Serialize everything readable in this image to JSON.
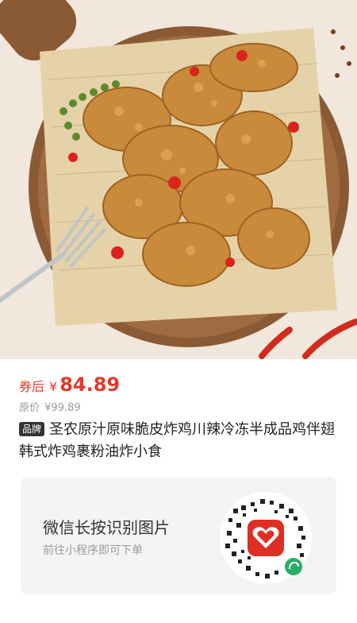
{
  "product": {
    "coupon_label": "券后",
    "currency": "¥",
    "price": "84.89",
    "original_label": "原价",
    "original_price": "¥99.89",
    "brand_badge": "品牌",
    "title": "圣农原汁原味脆皮炸鸡川辣冷冻半成品鸡伴翅韩式炸鸡裹粉油炸小食"
  },
  "qr_card": {
    "title": "微信长按识别图片",
    "subtitle": "前往小程序即可下单"
  },
  "colors": {
    "accent": "#e23a2c",
    "text": "#222222",
    "muted": "#9a9a9a",
    "card_bg": "#f4f4f4",
    "badge_bg": "#333333"
  }
}
